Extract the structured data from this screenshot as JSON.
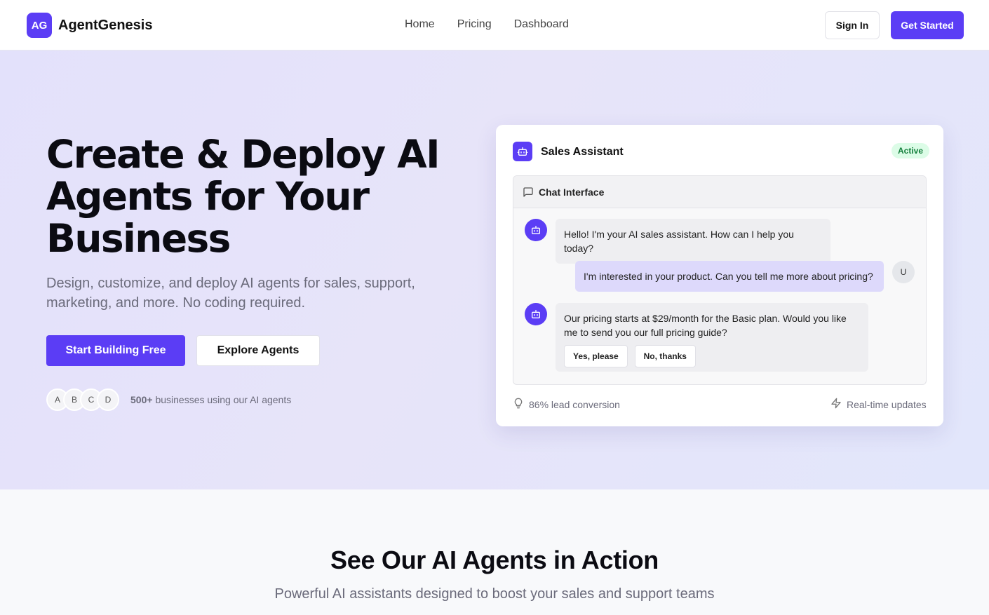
{
  "header": {
    "logo_badge": "AG",
    "brand": "AgentGenesis",
    "nav": [
      "Home",
      "Pricing",
      "Dashboard"
    ],
    "sign_in": "Sign In",
    "get_started": "Get Started"
  },
  "hero": {
    "title": "Create & Deploy AI Agents for Your Business",
    "subtitle": "Design, customize, and deploy AI agents for sales, support, marketing, and more. No coding required.",
    "primary_cta": "Start Building Free",
    "secondary_cta": "Explore Agents",
    "avatars": [
      "A",
      "B",
      "C",
      "D"
    ],
    "social_count": "500+",
    "social_text": "businesses using our AI agents"
  },
  "card": {
    "title": "Sales Assistant",
    "status": "Active",
    "chat_title": "Chat Interface",
    "messages": [
      {
        "from": "bot",
        "text": "Hello! I'm your AI sales assistant. How can I help you today?"
      },
      {
        "from": "user",
        "avatar": "U",
        "text": "I'm interested in your product. Can you tell me more about pricing?"
      },
      {
        "from": "bot",
        "text": "Our pricing starts at $29/month for the Basic plan. Would you like me to send you our full pricing guide?",
        "options": [
          "Yes, please",
          "No, thanks"
        ]
      }
    ],
    "stat_left": "86% lead conversion",
    "stat_right": "Real-time updates"
  },
  "section": {
    "title": "See Our AI Agents in Action",
    "subtitle": "Powerful AI assistants designed to boost your sales and support teams"
  },
  "colors": {
    "brand": "#5b3df5",
    "active_badge_bg": "#dcfce7",
    "active_badge_text": "#15803d"
  },
  "icons": {
    "card": "robot-icon",
    "chat": "message-square-icon",
    "stat_left": "lightbulb-icon",
    "stat_right": "lightning-icon"
  }
}
